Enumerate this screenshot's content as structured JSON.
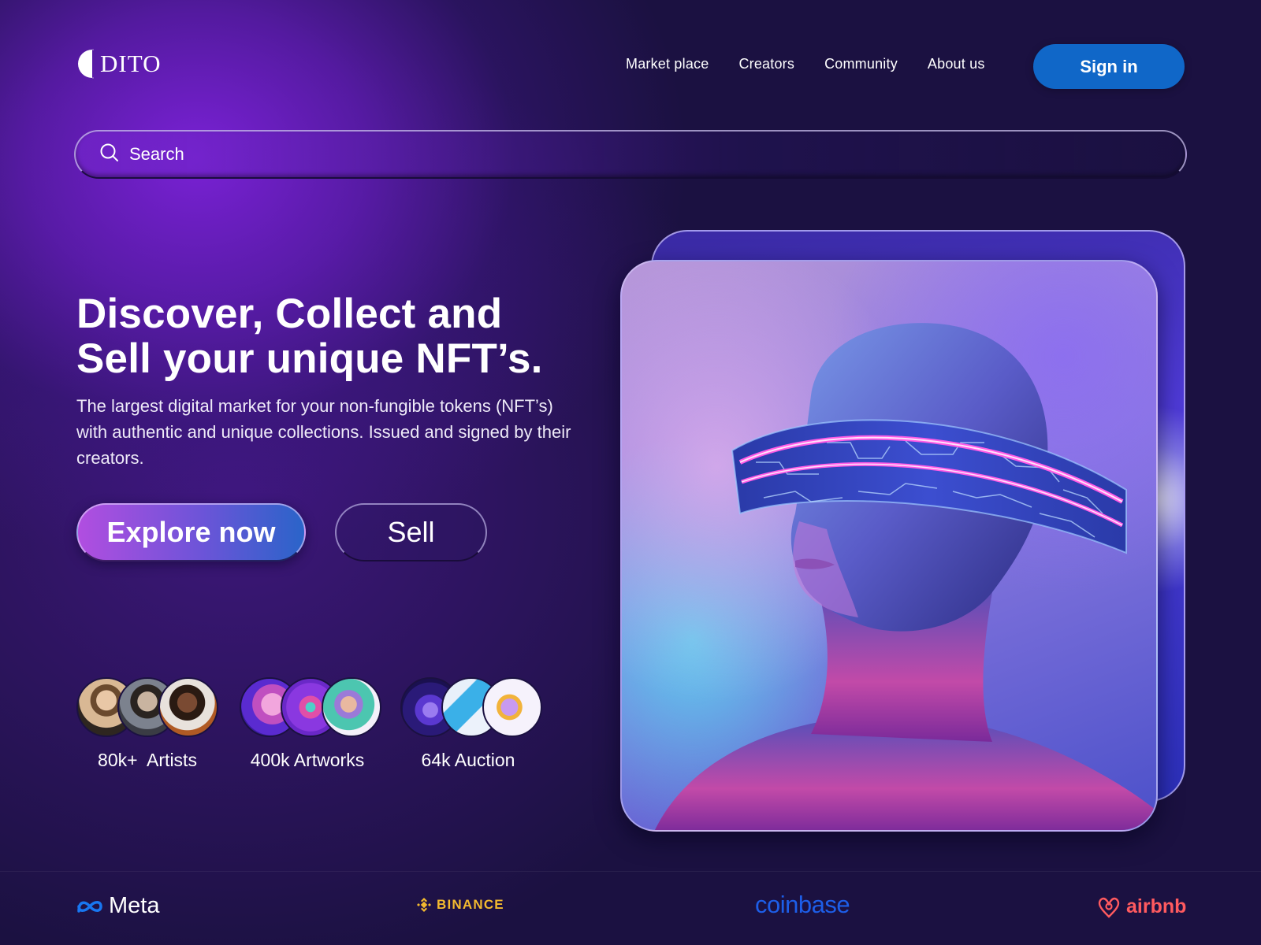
{
  "brand": {
    "name": "DITO"
  },
  "nav": {
    "items": [
      {
        "label": "Market place"
      },
      {
        "label": "Creators"
      },
      {
        "label": "Community"
      },
      {
        "label": "About us"
      }
    ],
    "signin_label": "Sign in"
  },
  "search": {
    "placeholder": "Search",
    "value": ""
  },
  "hero": {
    "headline_line1": "Discover, Collect and",
    "headline_line2": "Sell your unique NFT’s.",
    "description": "The largest digital market for your non-fungible tokens (NFT’s) with authentic and unique collections. Issued and signed by their creators.",
    "explore_label": "Explore now",
    "sell_label": "Sell"
  },
  "stats": [
    {
      "label": "80k+  Artists"
    },
    {
      "label": "400k Artworks"
    },
    {
      "label": "64k Auction"
    }
  ],
  "partners": {
    "meta": "Meta",
    "binance": "BINANCE",
    "coinbase": "coinbase",
    "airbnb": "airbnb"
  },
  "colors": {
    "background": "#1b1141",
    "signin_button": "#1067c8",
    "explore_gradient_start": "#b14ee0",
    "explore_gradient_end": "#2a64c9",
    "binance": "#f3ba2f",
    "coinbase": "#1d5ee8",
    "airbnb": "#ff5a5f"
  },
  "icons": {
    "search": "search-icon",
    "logo": "half-moon-logo-icon"
  }
}
